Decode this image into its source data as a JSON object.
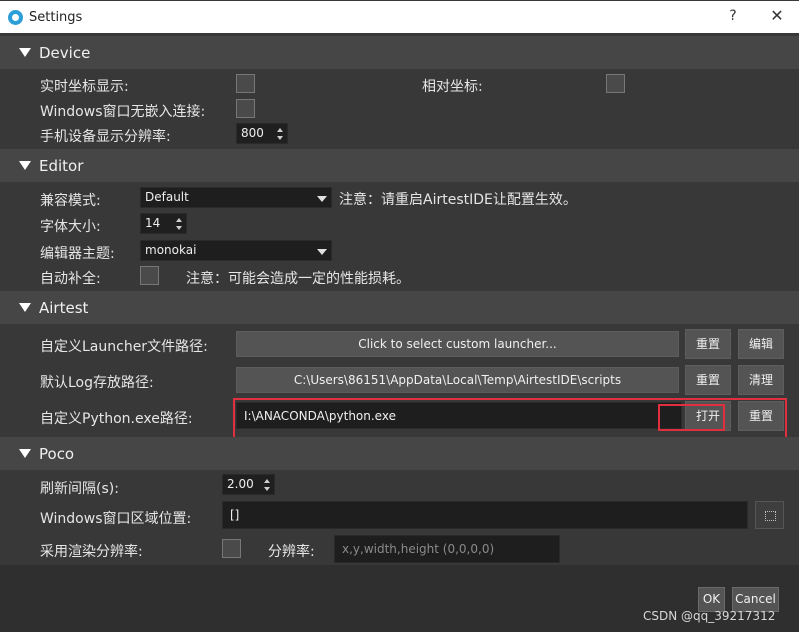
{
  "window": {
    "title": "Settings",
    "help_label": "?",
    "close_label": "✕"
  },
  "device": {
    "header": "Device",
    "realtime_coords_label": "实时坐标显示:",
    "relative_coords_label": "相对坐标:",
    "windows_no_embed_label": "Windows窗口无嵌入连接:",
    "resolution_label": "手机设备显示分辨率:",
    "resolution_value": "800"
  },
  "editor": {
    "header": "Editor",
    "compat_label": "兼容模式:",
    "compat_value": "Default",
    "restart_note": "注意：请重启AirtestIDE让配置生效。",
    "font_size_label": "字体大小:",
    "font_size_value": "14",
    "theme_label": "编辑器主题:",
    "theme_value": "monokai",
    "autocomplete_label": "自动补全:",
    "perf_note": "注意：可能会造成一定的性能损耗。"
  },
  "airtest": {
    "header": "Airtest",
    "launcher_label": "自定义Launcher文件路径:",
    "launcher_button": "Click to select custom launcher...",
    "launcher_reset": "重置",
    "launcher_edit": "编辑",
    "log_label": "默认Log存放路径:",
    "log_path": "C:\\Users\\86151\\AppData\\Local\\Temp\\AirtestIDE\\scripts",
    "log_reset": "重置",
    "log_clean": "清理",
    "python_label": "自定义Python.exe路径:",
    "python_path": "I:\\ANACONDA\\python.exe",
    "python_open": "打开",
    "python_reset": "重置"
  },
  "poco": {
    "header": "Poco",
    "refresh_label": "刷新间隔(s):",
    "refresh_value": "2.00",
    "window_region_label": "Windows窗口区域位置:",
    "window_region_value": "[]",
    "render_res_label": "采用渲染分辨率:",
    "resolution_label": "分辨率:",
    "resolution_placeholder": "x,y,width,height (0,0,0,0)"
  },
  "footer": {
    "ok_label": "OK",
    "cancel_label": "Cancel",
    "watermark": "CSDN @qq_39217312"
  },
  "colors": {
    "background": "#383838",
    "section_header": "#464646",
    "highlight_box": "#e03040",
    "app_icon": "#2d9fd8"
  },
  "icons": [
    "settings-app-icon",
    "help-icon",
    "close-icon",
    "collapse-triangle-icon",
    "dropdown-arrow-icon",
    "spin-arrows-icon",
    "expand-icon"
  ]
}
